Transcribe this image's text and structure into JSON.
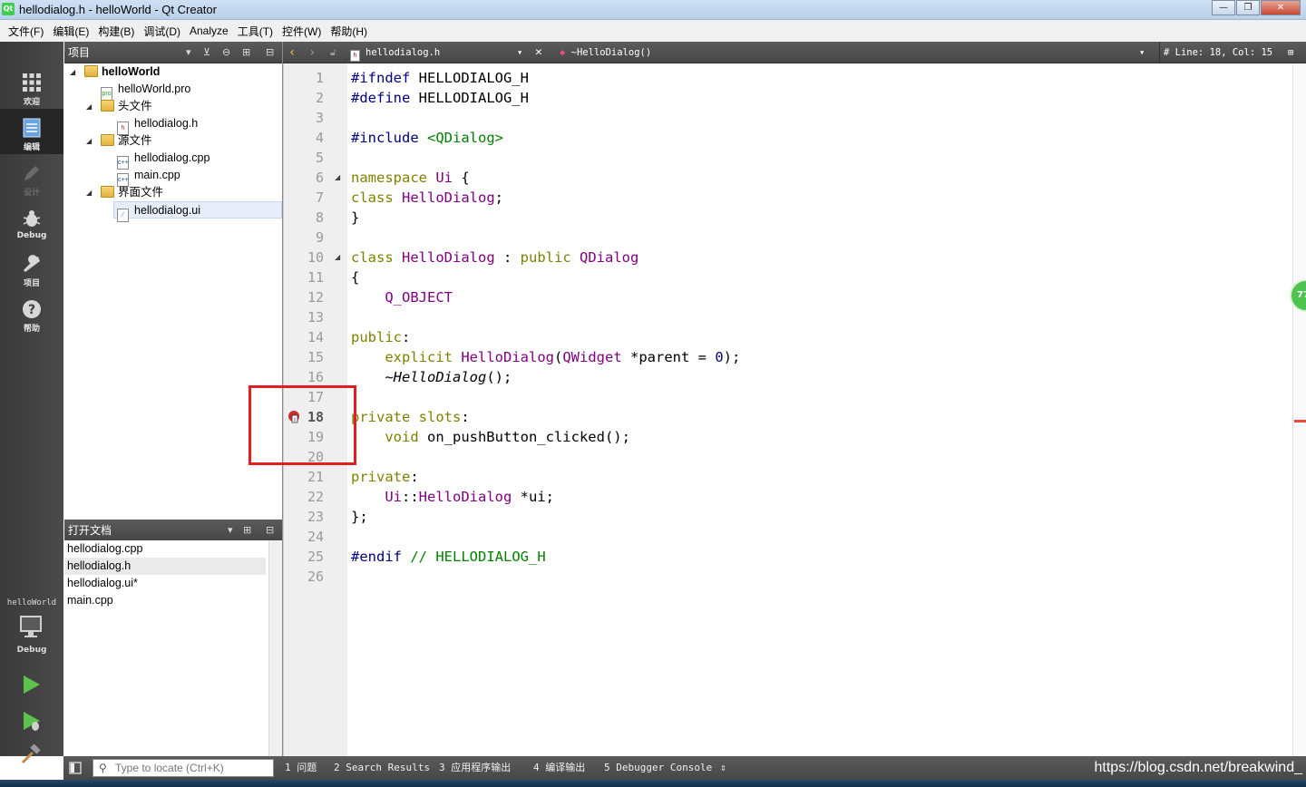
{
  "window": {
    "title": "hellodialog.h - helloWorld - Qt Creator"
  },
  "menu": [
    "文件(F)",
    "编辑(E)",
    "构建(B)",
    "调试(D)",
    "Analyze",
    "工具(T)",
    "控件(W)",
    "帮助(H)"
  ],
  "modes": [
    {
      "label": "欢迎",
      "icon": "grid-icon",
      "active": false,
      "disabled": false
    },
    {
      "label": "编辑",
      "icon": "document-icon",
      "active": true,
      "disabled": false
    },
    {
      "label": "设计",
      "icon": "pencil-icon",
      "active": false,
      "disabled": true
    },
    {
      "label": "Debug",
      "icon": "bug-icon",
      "active": false,
      "disabled": false
    },
    {
      "label": "项目",
      "icon": "wrench-icon",
      "active": false,
      "disabled": false
    },
    {
      "label": "帮助",
      "icon": "help-icon",
      "active": false,
      "disabled": false
    }
  ],
  "kit": {
    "project": "helloWorld",
    "config": "Debug"
  },
  "projects_pane": {
    "title": "项目",
    "tree": [
      {
        "label": "helloWorld",
        "kind": "project"
      },
      {
        "label": "helloWorld.pro",
        "kind": "pro"
      },
      {
        "label": "头文件",
        "kind": "folder"
      },
      {
        "label": "hellodialog.h",
        "kind": "h"
      },
      {
        "label": "源文件",
        "kind": "folder"
      },
      {
        "label": "hellodialog.cpp",
        "kind": "cpp"
      },
      {
        "label": "main.cpp",
        "kind": "cpp"
      },
      {
        "label": "界面文件",
        "kind": "folder"
      },
      {
        "label": "hellodialog.ui",
        "kind": "ui"
      }
    ]
  },
  "open_docs_pane": {
    "title": "打开文档",
    "docs": [
      "hellodialog.cpp",
      "hellodialog.h",
      "hellodialog.ui*",
      "main.cpp"
    ],
    "selected_index": 1
  },
  "editor": {
    "file": "hellodialog.h",
    "symbol": "~HelloDialog()",
    "position": "#  Line: 18, Col: 15",
    "current_line": 18,
    "breakpoint_line": 18,
    "lines": [
      "#ifndef HELLODIALOG_H",
      "#define HELLODIALOG_H",
      "",
      "#include <QDialog>",
      "",
      "namespace Ui {",
      "class HelloDialog;",
      "}",
      "",
      "class HelloDialog : public QDialog",
      "{",
      "    Q_OBJECT",
      "",
      "public:",
      "    explicit HelloDialog(QWidget *parent = 0);",
      "    ~HelloDialog();",
      "",
      "private slots:",
      "    void on_pushButton_clicked();",
      "",
      "private:",
      "    Ui::HelloDialog *ui;",
      "};",
      "",
      "#endif // HELLODIALOG_H",
      ""
    ]
  },
  "bottom": {
    "locator_placeholder": "Type to locate (Ctrl+K)",
    "tabs": [
      "1  问题",
      "2  Search Results",
      "3  应用程序输出",
      "4  编译输出",
      "5  Debugger Console"
    ],
    "watermark": "https://blog.csdn.net/breakwind_"
  },
  "side_badge": "77"
}
